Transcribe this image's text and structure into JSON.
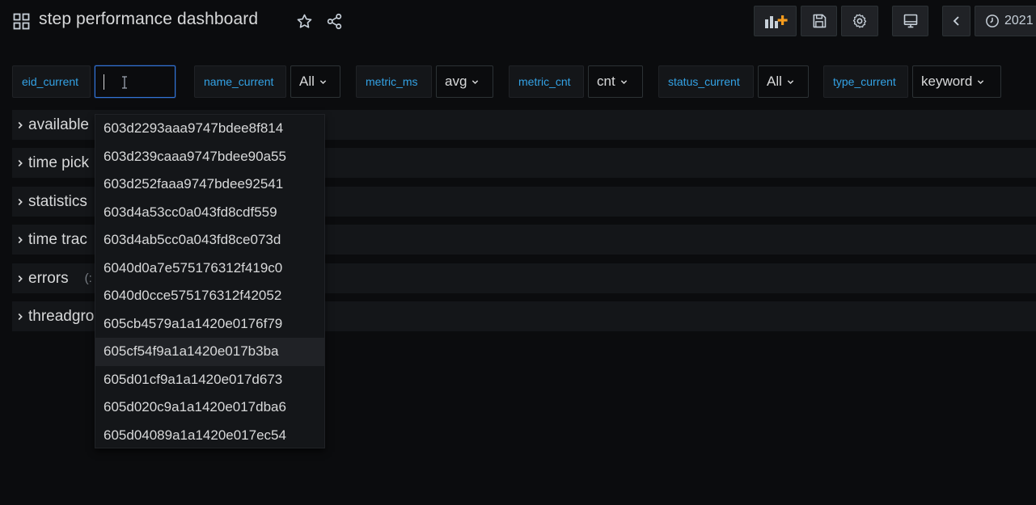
{
  "header": {
    "title": "step performance dashboard",
    "time_range_label": "2021",
    "icons": [
      "apps-grid-icon",
      "star-icon",
      "share-icon",
      "add-panel-icon",
      "save-icon",
      "gear-icon",
      "tv-mode-icon",
      "chevron-left-icon",
      "clock-icon"
    ]
  },
  "variables": {
    "eid": {
      "label": "eid_current",
      "value": ""
    },
    "name": {
      "label": "name_current",
      "value": "All"
    },
    "metric_ms": {
      "label": "metric_ms",
      "value": "avg"
    },
    "metric_cnt": {
      "label": "metric_cnt",
      "value": "cnt"
    },
    "status": {
      "label": "status_current",
      "value": "All"
    },
    "type": {
      "label": "type_current",
      "value": "keyword"
    }
  },
  "rows": [
    {
      "title": "available",
      "count": ""
    },
    {
      "title": "time pick",
      "count": ""
    },
    {
      "title": "statistics",
      "count": ""
    },
    {
      "title": "time trac",
      "count": ""
    },
    {
      "title": "errors",
      "count": "(:"
    },
    {
      "title": "threadgro",
      "count": ""
    }
  ],
  "dropdown": {
    "highlighted_index": 8,
    "options": [
      "603d2293aaa9747bdee8f814",
      "603d239caaa9747bdee90a55",
      "603d252faaa9747bdee92541",
      "603d4a53cc0a043fd8cdf559",
      "603d4ab5cc0a043fd8ce073d",
      "6040d0a7e575176312f419c0",
      "6040d0cce575176312f42052",
      "605cb4579a1a1420e0176f79",
      "605cf54f9a1a1420e017b3ba",
      "605d01cf9a1a1420e017d673",
      "605d020c9a1a1420e017dba6",
      "605d04089a1a1420e017ec54"
    ]
  },
  "colors": {
    "background": "#0b0c0e",
    "variable_label": "#33a2e5",
    "focus_border": "#3274d9",
    "add_panel_accent": "#f59b1d"
  }
}
